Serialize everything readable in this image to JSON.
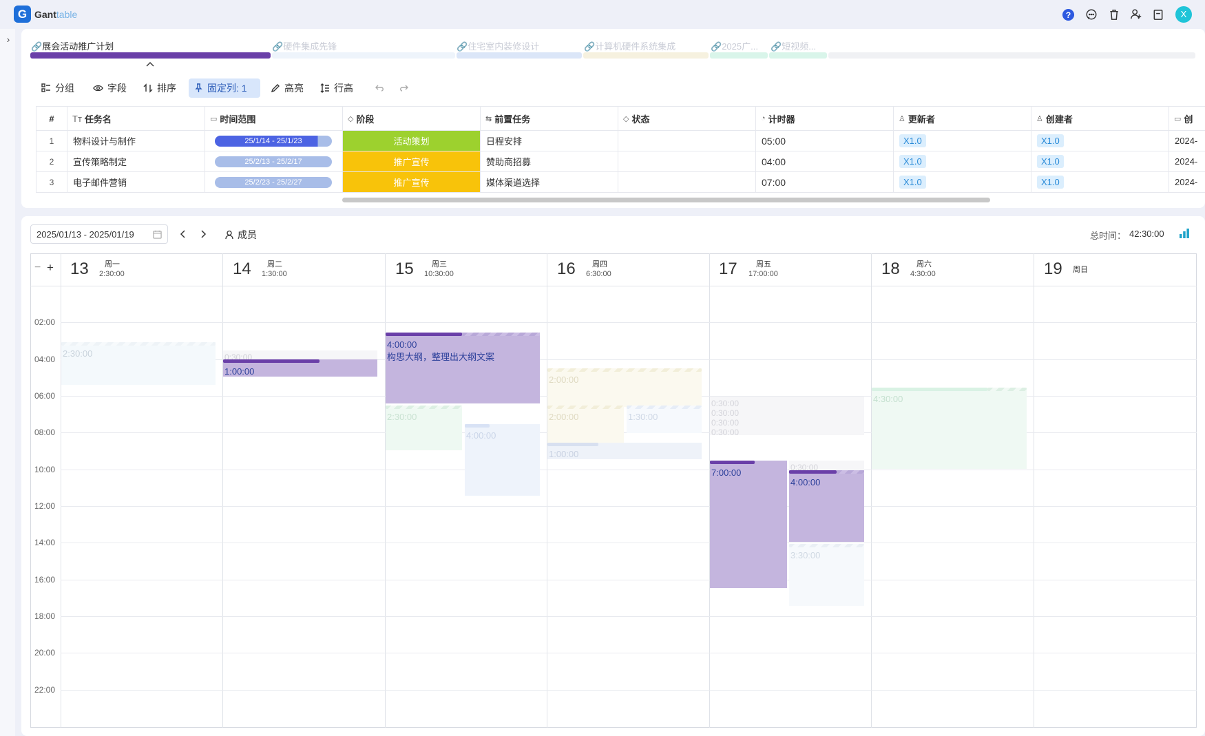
{
  "app": {
    "brand_main": "Gant",
    "brand_sub": "table",
    "logo_letter": "G",
    "avatar_letter": "X"
  },
  "project_tabs": [
    {
      "label": "展会活动推广计划",
      "active": true,
      "color": "#6a3fa8"
    },
    {
      "label": "硬件集成先锋",
      "active": false,
      "color": "#eef4fb"
    },
    {
      "label": "住宅室内装修设计",
      "active": false,
      "color": "#dbe6f8"
    },
    {
      "label": "计算机硬件系统集成",
      "active": false,
      "color": "#f6f1df"
    },
    {
      "label": "2025广...",
      "active": false,
      "color": "#d9f5ea"
    },
    {
      "label": "短视频...",
      "active": false,
      "color": "#d9f5ea"
    }
  ],
  "toolbar": {
    "group": "分组",
    "fields": "字段",
    "sort": "排序",
    "pinned": "固定列: 1",
    "highlight": "高亮",
    "row_height": "行高"
  },
  "table": {
    "columns": [
      "#",
      "任务名",
      "时间范围",
      "阶段",
      "前置任务",
      "状态",
      "计时器",
      "更新者",
      "创建者",
      "创"
    ],
    "rows": [
      {
        "num": "1",
        "name": "物料设计与制作",
        "range": "25/1/14 - 25/1/23",
        "range_color": "#4c63e3",
        "stage": "活动策划",
        "stage_color": "#9dd12e",
        "prev": "日程安排",
        "status": "",
        "timer": "05:00",
        "updater": "X1.0",
        "creator": "X1.0",
        "created": "2024-"
      },
      {
        "num": "2",
        "name": "宣传策略制定",
        "range": "25/2/13 - 25/2/17",
        "range_color": "#a8bde8",
        "stage": "推广宣传",
        "stage_color": "#f8c30a",
        "prev": "赞助商招募",
        "status": "",
        "timer": "04:00",
        "updater": "X1.0",
        "creator": "X1.0",
        "created": "2024-"
      },
      {
        "num": "3",
        "name": "电子邮件营销",
        "range": "25/2/23 - 25/2/27",
        "range_color": "#a8bde8",
        "stage": "推广宣传",
        "stage_color": "#f8c30a",
        "prev": "媒体渠道选择",
        "status": "",
        "timer": "07:00",
        "updater": "X1.0",
        "creator": "X1.0",
        "created": "2024-"
      }
    ]
  },
  "calendar": {
    "date_range": "2025/01/13 - 2025/01/19",
    "members_label": "成员",
    "total_label": "总时间：",
    "total_value": "42:30:00",
    "zoom_minus": "−",
    "zoom_plus": "+",
    "days": [
      {
        "num": "13",
        "weekday": "周一",
        "total": "2:30:00"
      },
      {
        "num": "14",
        "weekday": "周二",
        "total": "1:30:00"
      },
      {
        "num": "15",
        "weekday": "周三",
        "total": "10:30:00"
      },
      {
        "num": "16",
        "weekday": "周四",
        "total": "6:30:00"
      },
      {
        "num": "17",
        "weekday": "周五",
        "total": "17:00:00"
      },
      {
        "num": "18",
        "weekday": "周六",
        "total": "4:30:00"
      },
      {
        "num": "19",
        "weekday": "周日",
        "total": ""
      }
    ],
    "hours": [
      "02:00",
      "04:00",
      "06:00",
      "08:00",
      "10:00",
      "12:00",
      "14:00",
      "16:00",
      "18:00",
      "20:00",
      "22:00"
    ],
    "events": [
      {
        "duration": "2:30:00",
        "title": ""
      },
      {
        "duration": "0:30:00",
        "title": ""
      },
      {
        "duration": "1:00:00",
        "title": ""
      },
      {
        "duration": "4:00:00",
        "title": "构思大纲，整理出大纲文案"
      },
      {
        "duration": "2:30:00",
        "title": ""
      },
      {
        "duration": "4:00:00",
        "title": ""
      },
      {
        "duration": "2:00:00",
        "title": ""
      },
      {
        "duration": "2:00:00",
        "title": ""
      },
      {
        "duration": "1:30:00",
        "title": ""
      },
      {
        "duration": "1:00:00",
        "title": ""
      },
      {
        "duration": "0:30:00",
        "title": ""
      },
      {
        "duration": "0:30:00",
        "title": ""
      },
      {
        "duration": "0:30:00",
        "title": ""
      },
      {
        "duration": "0:30:00",
        "title": ""
      },
      {
        "duration": "7:00:00",
        "title": ""
      },
      {
        "duration": "0:30:00",
        "title": ""
      },
      {
        "duration": "4:00:00",
        "title": ""
      },
      {
        "duration": "3:30:00",
        "title": ""
      },
      {
        "duration": "4:30:00",
        "title": ""
      }
    ]
  },
  "colors": {
    "accent": "#6a3fa8",
    "active_block": "#c4b5de",
    "primary_blue": "#1e6fd9"
  }
}
